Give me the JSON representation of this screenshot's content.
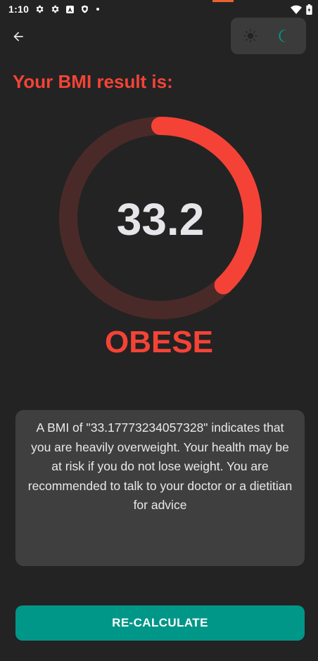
{
  "status_bar": {
    "time": "1:10",
    "icons_left": [
      "settings-icon",
      "settings-icon",
      "a-badge-icon",
      "shield-icon",
      "dot-icon"
    ],
    "icons_right": [
      "wifi-icon",
      "battery-icon"
    ]
  },
  "header": {
    "back_icon": "arrow-back-icon",
    "theme_toggle": {
      "light_icon": "sun-icon",
      "dark_icon": "moon-icon",
      "selected": "dark"
    }
  },
  "result": {
    "heading": "Your BMI result is:",
    "value": "33.2",
    "category": "OBESE",
    "gauge_fraction": 0.38
  },
  "advice": {
    "text": "A BMI of \"33.17773234057328\" indicates that you are heavily overweight. Your health may be at risk if you do not lose weight. You are recommended to talk to your doctor or a dietitian for advice"
  },
  "actions": {
    "recalculate_label": "RE-CALCULATE"
  },
  "colors": {
    "background": "#232323",
    "accent_red": "#f44336",
    "gauge_track": "#4a2a28",
    "teal": "#009688",
    "card": "#3f3f3f",
    "toggle_bg": "#3b3b3b"
  }
}
